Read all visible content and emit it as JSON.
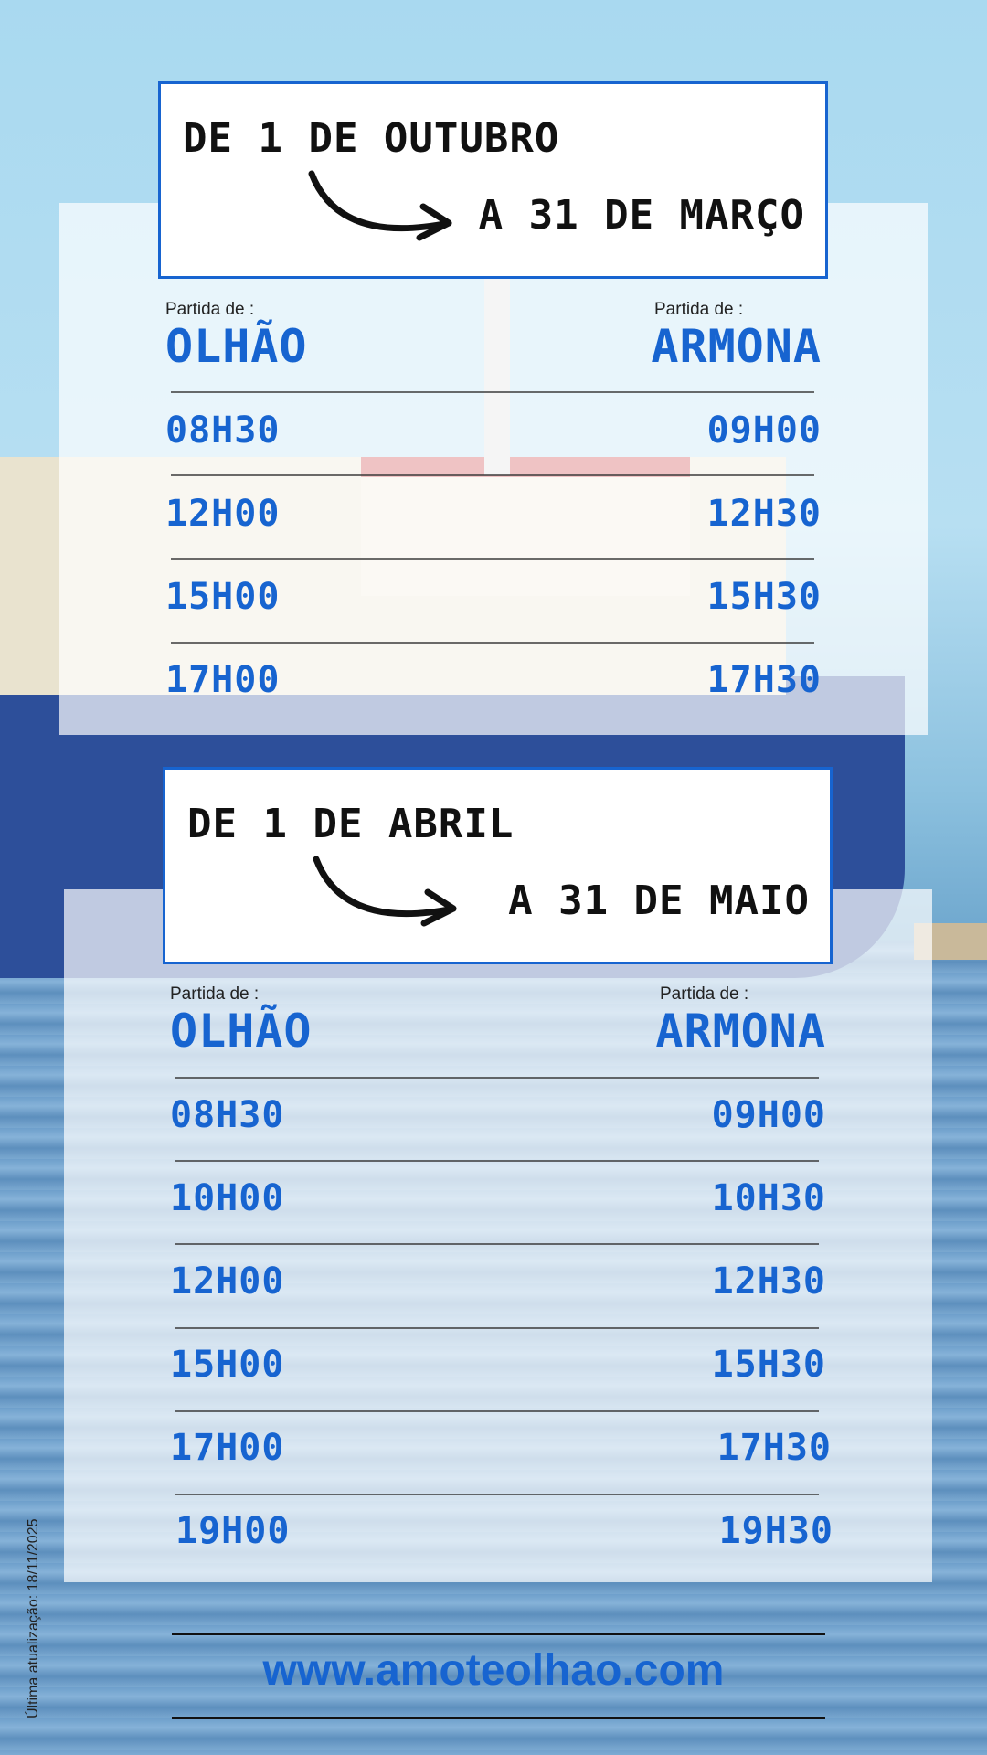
{
  "colors": {
    "accent": "#1764d0",
    "text": "#111111",
    "panel": "rgba(255,255,255,0.70)"
  },
  "schedules": [
    {
      "from_label": "DE 1 DE OUTUBRO",
      "to_label": "A 31 DE MARÇO",
      "left_caption": "Partida de :",
      "left_title": "OLHÃO",
      "right_caption": "Partida de :",
      "right_title": "ARMONA",
      "rows": [
        {
          "olhao": "08H30",
          "armona": "09H00"
        },
        {
          "olhao": "12H00",
          "armona": "12H30"
        },
        {
          "olhao": "15H00",
          "armona": "15H30"
        },
        {
          "olhao": "17H00",
          "armona": "17H30"
        }
      ]
    },
    {
      "from_label": "DE 1 DE ABRIL",
      "to_label": "A 31 DE MAIO",
      "left_caption": "Partida de :",
      "left_title": "OLHÃO",
      "right_caption": "Partida de :",
      "right_title": "ARMONA",
      "rows": [
        {
          "olhao": "08H30",
          "armona": "09H00"
        },
        {
          "olhao": "10H00",
          "armona": "10H30"
        },
        {
          "olhao": "12H00",
          "armona": "12H30"
        },
        {
          "olhao": "15H00",
          "armona": "15H30"
        },
        {
          "olhao": "17H00",
          "armona": "17H30"
        },
        {
          "olhao": "19H00",
          "armona": "19H30"
        }
      ]
    }
  ],
  "footer": {
    "website": "www.amoteolhao.com",
    "update_note": "Última atualização: 18/11/2025"
  },
  "icons": [
    "curved-arrow-icon"
  ]
}
